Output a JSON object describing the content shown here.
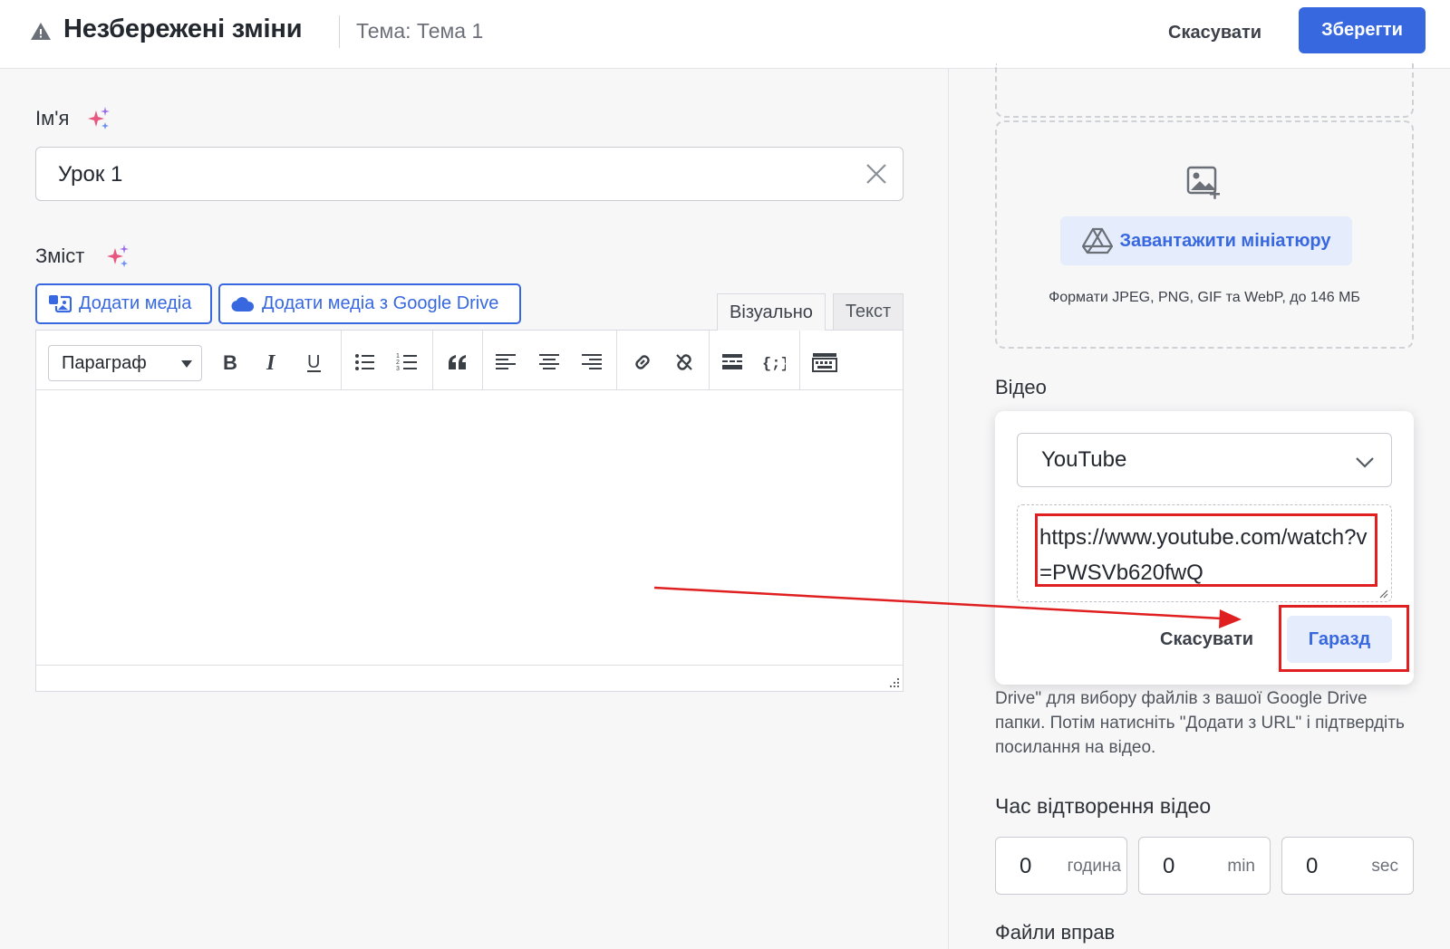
{
  "header": {
    "title": "Незбережені зміни",
    "topic": "Тема: Тема 1",
    "cancel_label": "Скасувати",
    "save_label": "Зберегти"
  },
  "name_field": {
    "label": "Ім'я",
    "value": "Урок 1"
  },
  "content_field": {
    "label": "Зміст",
    "add_media_label": "Додати медіа",
    "add_drive_label": "Додати медіа з Google Drive",
    "tabs": [
      {
        "label": "Візуально",
        "active": true
      },
      {
        "label": "Текст",
        "active": false
      }
    ],
    "format_select": "Параграф",
    "toolbar_icons": [
      "bold-icon",
      "italic-icon",
      "underline-icon",
      "bullet-list-icon",
      "numbered-list-icon",
      "blockquote-icon",
      "align-left-icon",
      "align-center-icon",
      "align-right-icon",
      "link-icon",
      "unlink-icon",
      "read-more-icon",
      "code-icon",
      "keyboard-icon"
    ]
  },
  "thumbnail": {
    "upload_label": "Завантажити мініатюру",
    "formats_text": "Формати JPEG, PNG, GIF та WebP, до 146 МБ"
  },
  "video": {
    "label": "Відео",
    "provider": "YouTube",
    "url": "https://www.youtube.com/watch?v=PWSVb620fwQ",
    "cancel_label": "Скасувати",
    "ok_label": "Гаразд",
    "help_text": "Drive\" для вибору файлів з вашої Google Drive папки. Потім натисніть \"Додати з URL\" і підтвердіть посилання на відео."
  },
  "playback_time": {
    "label": "Час відтворення відео",
    "hours": {
      "value": "0",
      "unit": "година"
    },
    "minutes": {
      "value": "0",
      "unit": "min"
    },
    "seconds": {
      "value": "0",
      "unit": "sec"
    }
  },
  "exercise_files": {
    "label": "Файли вправ"
  },
  "colors": {
    "accent": "#3868df",
    "annotation": "#e02020"
  }
}
